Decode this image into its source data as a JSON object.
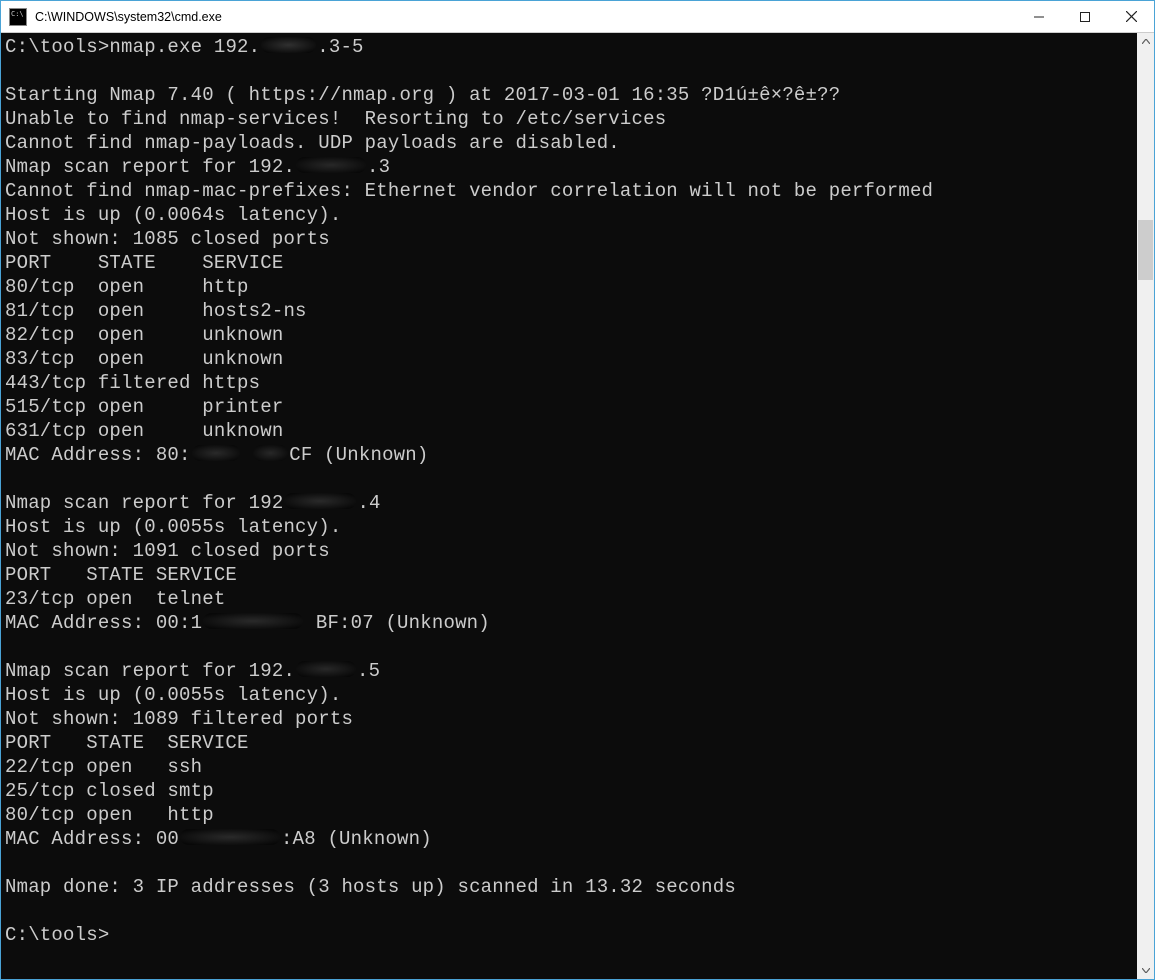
{
  "window": {
    "title": "C:\\WINDOWS\\system32\\cmd.exe"
  },
  "terminal": {
    "prompt1_pre": "C:\\tools>",
    "cmd_pre": "nmap.exe 192.",
    "cmd_post": ".3-5",
    "blank": "",
    "start_line": "Starting Nmap 7.40 ( https://nmap.org ) at 2017-03-01 16:35 ?D1ú±ê×?ê±??",
    "svc_line": "Unable to find nmap-services!  Resorting to /etc/services",
    "pay_line": "Cannot find nmap-payloads. UDP payloads are disabled.",
    "rep1_pre": "Nmap scan report for 192.",
    "rep1_post": ".3",
    "macpref": "Cannot find nmap-mac-prefixes: Ethernet vendor correlation will not be performed",
    "host1": "Host is up (0.0064s latency).",
    "nshown1": "Not shown: 1085 closed ports",
    "hdr1": "PORT    STATE    SERVICE",
    "p1_1": "80/tcp  open     http",
    "p1_2": "81/tcp  open     hosts2-ns",
    "p1_3": "82/tcp  open     unknown",
    "p1_4": "83/tcp  open     unknown",
    "p1_5": "443/tcp filtered https",
    "p1_6": "515/tcp open     printer",
    "p1_7": "631/tcp open     unknown",
    "mac1_pre": "MAC Address: 80:",
    "mac1_post": "CF (Unknown)",
    "rep2_pre": "Nmap scan report for 192",
    "rep2_post": ".4",
    "host2": "Host is up (0.0055s latency).",
    "nshown2": "Not shown: 1091 closed ports",
    "hdr2": "PORT   STATE SERVICE",
    "p2_1": "23/tcp open  telnet",
    "mac2_pre": "MAC Address: 00:1",
    "mac2_mid": "BF:07 (Unknown)",
    "rep3_pre": "Nmap scan report for 192.",
    "rep3_post": ".5",
    "host3": "Host is up (0.0055s latency).",
    "nshown3": "Not shown: 1089 filtered ports",
    "hdr3": "PORT   STATE  SERVICE",
    "p3_1": "22/tcp open   ssh",
    "p3_2": "25/tcp closed smtp",
    "p3_3": "80/tcp open   http",
    "mac3_pre": "MAC Address: 00",
    "mac3_post": ":A8 (Unknown)",
    "done": "Nmap done: 3 IP addresses (3 hosts up) scanned in 13.32 seconds",
    "prompt2": "C:\\tools>"
  }
}
